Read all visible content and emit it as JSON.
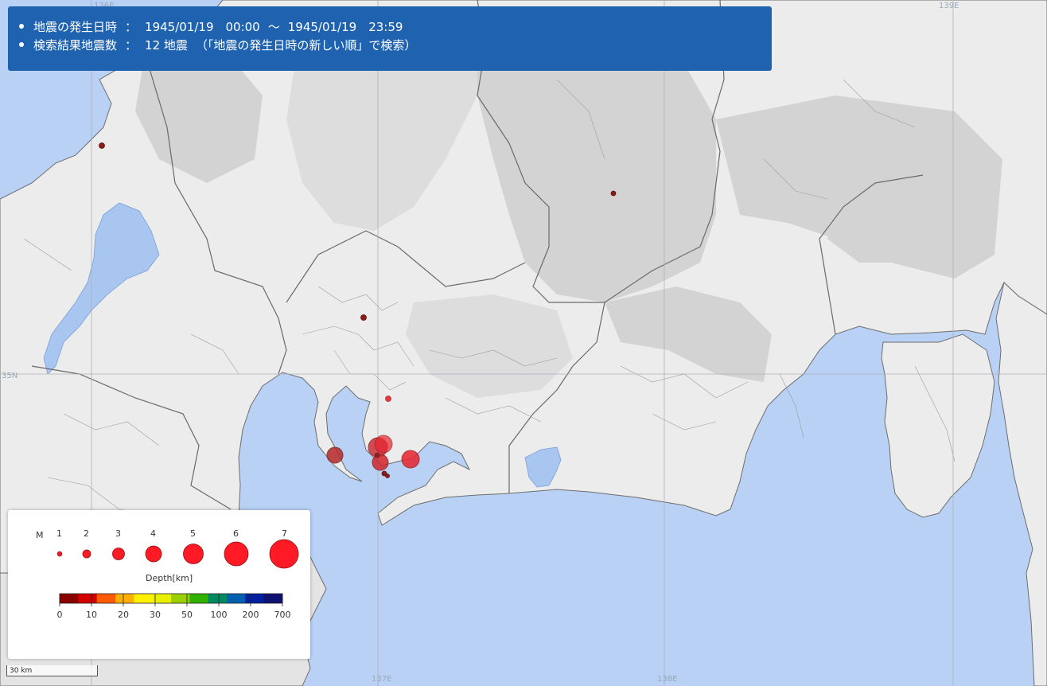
{
  "info": {
    "line1": {
      "label": "地震の発生日時",
      "colon": "：",
      "start": "1945/01/19　00:00",
      "tilde": "～",
      "end": "1945/01/19　23:59"
    },
    "line2": {
      "label": "検索結果地震数",
      "colon": "：",
      "count": "12 地震",
      "note": "（「地震の発生日時の新しい順」で検索）"
    }
  },
  "graticule": {
    "lon_labels": [
      "136E",
      "137E",
      "138E",
      "139E"
    ],
    "lat_labels": [
      "35N"
    ]
  },
  "colors": {
    "sea": "#b8d1f5",
    "land": "#ececec",
    "mountains": "#c9c9c9",
    "lake": "#a9c6f0",
    "info_bg": "#1f63b0",
    "quake_fill": "#e8242f",
    "quake_dark": "#8b1c1c"
  },
  "legend": {
    "m_label": "M",
    "magnitudes": [
      "1",
      "2",
      "3",
      "4",
      "5",
      "6",
      "7"
    ],
    "depth_title": "Depth[km]",
    "depth_ticks": [
      "0",
      "10",
      "20",
      "30",
      "50",
      "100",
      "200",
      "700"
    ],
    "depth_colors": [
      "#8b0000",
      "#d40000",
      "#ff5a00",
      "#ffb000",
      "#fff000",
      "#e8f000",
      "#9ad000",
      "#30b000",
      "#008a60",
      "#0060b0",
      "#0020a0",
      "#101070"
    ]
  },
  "scale_bar": {
    "label": "30 km"
  }
}
